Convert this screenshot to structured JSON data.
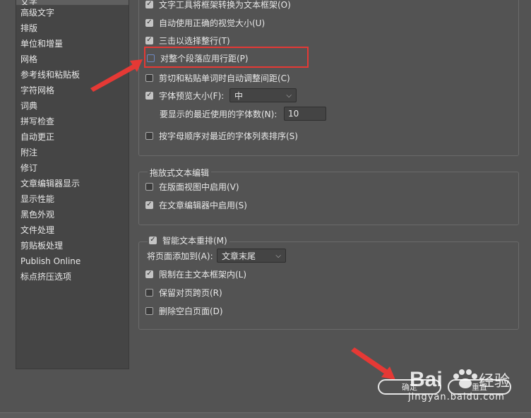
{
  "sidebar": {
    "items": [
      {
        "label": "文字",
        "selected": true
      },
      {
        "label": "高级文字"
      },
      {
        "label": "排版"
      },
      {
        "label": "单位和增量"
      },
      {
        "label": "网格"
      },
      {
        "label": "参考线和粘贴板"
      },
      {
        "label": "字符网格"
      },
      {
        "label": "词典"
      },
      {
        "label": "拼写检查"
      },
      {
        "label": "自动更正"
      },
      {
        "label": "附注"
      },
      {
        "label": "修订"
      },
      {
        "label": "文章编辑器显示"
      },
      {
        "label": "显示性能"
      },
      {
        "label": "黑色外观"
      },
      {
        "label": "文件处理"
      },
      {
        "label": "剪贴板处理"
      },
      {
        "label": "Publish Online"
      },
      {
        "label": "标点挤压选项"
      }
    ]
  },
  "type_options": {
    "convert_frames": {
      "label": "文字工具将框架转换为文本框架(O)",
      "checked": true
    },
    "optical_size": {
      "label": "自动使用正确的视觉大小(U)",
      "checked": true
    },
    "triple_click": {
      "label": "三击以选择整行(T)",
      "checked": true
    },
    "leading_whole_para": {
      "label": "对整个段落应用行距(P)",
      "checked": false
    },
    "cut_paste_spacing": {
      "label": "剪切和粘贴单词时自动调整间距(C)",
      "checked": false
    },
    "font_preview": {
      "label": "字体预览大小(F):",
      "checked": true,
      "value": "中"
    },
    "recent_fonts": {
      "label": "要显示的最近使用的字体数(N):",
      "value": "10"
    },
    "sort_recent": {
      "label": "按字母顺序对最近的字体列表排序(S)",
      "checked": false
    }
  },
  "drag_drop": {
    "title": "拖放式文本编辑",
    "layout_view": {
      "label": "在版面视图中启用(V)",
      "checked": false
    },
    "story_editor": {
      "label": "在文章编辑器中启用(S)",
      "checked": true
    }
  },
  "smart_reflow": {
    "title": "智能文本重排(M)",
    "checked": true,
    "add_pages": {
      "label": "将页面添加到(A):",
      "value": "文章末尾"
    },
    "limit_primary": {
      "label": "限制在主文本框架内(L)",
      "checked": true
    },
    "preserve_spreads": {
      "label": "保留对页跨页(R)",
      "checked": false
    },
    "delete_empty": {
      "label": "删除空白页面(D)",
      "checked": false
    }
  },
  "buttons": {
    "ok": "确定",
    "reset": "重置"
  },
  "watermark": {
    "brand": "Bai",
    "brand2": "经验",
    "url": "jingyan.baidu.com"
  },
  "colors": {
    "annotation": "#e53935",
    "checkbox_checked": "#c4c4c4",
    "background": "#535353"
  }
}
